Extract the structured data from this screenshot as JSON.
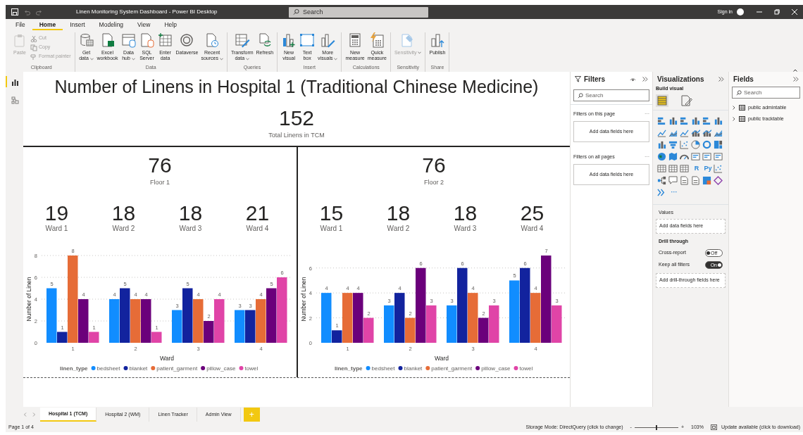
{
  "window": {
    "title": "Linen Monitoring System Dashboard - Power BI Desktop",
    "search_placeholder": "Search",
    "sign_in": "Sign in"
  },
  "menu_tabs": [
    {
      "label": "File",
      "selected": false
    },
    {
      "label": "Home",
      "selected": true
    },
    {
      "label": "Insert",
      "selected": false
    },
    {
      "label": "Modeling",
      "selected": false
    },
    {
      "label": "View",
      "selected": false
    },
    {
      "label": "Help",
      "selected": false
    }
  ],
  "ribbon": [
    {
      "label": "Clipboard",
      "buttons": [
        {
          "kind": "large",
          "lines": [
            "Paste"
          ],
          "disabled": true
        },
        {
          "kind": "small",
          "lines": [
            "Cut"
          ],
          "disabled": true
        },
        {
          "kind": "small",
          "lines": [
            "Copy"
          ],
          "disabled": true
        },
        {
          "kind": "small",
          "lines": [
            "Format painter"
          ],
          "disabled": true
        }
      ]
    },
    {
      "label": "Data",
      "buttons": [
        {
          "kind": "large",
          "lines": [
            "Get",
            "data"
          ],
          "dropdown": true,
          "disabled": false
        },
        {
          "kind": "large",
          "lines": [
            "Excel",
            "workbook"
          ],
          "disabled": false
        },
        {
          "kind": "large",
          "lines": [
            "Data",
            "hub"
          ],
          "dropdown": true,
          "disabled": false
        },
        {
          "kind": "large",
          "lines": [
            "SQL",
            "Server"
          ],
          "disabled": false
        },
        {
          "kind": "large",
          "lines": [
            "Enter",
            "data"
          ],
          "disabled": false
        },
        {
          "kind": "large",
          "lines": [
            "Dataverse"
          ],
          "disabled": false
        },
        {
          "kind": "large",
          "lines": [
            "Recent",
            "sources"
          ],
          "dropdown": true,
          "disabled": false
        }
      ]
    },
    {
      "label": "Queries",
      "buttons": [
        {
          "kind": "large",
          "lines": [
            "Transform",
            "data"
          ],
          "dropdown": true,
          "disabled": false
        },
        {
          "kind": "large",
          "lines": [
            "Refresh"
          ],
          "disabled": false
        }
      ]
    },
    {
      "label": "Insert",
      "buttons": [
        {
          "kind": "large",
          "lines": [
            "New",
            "visual"
          ],
          "disabled": false
        },
        {
          "kind": "large",
          "lines": [
            "Text",
            "box"
          ],
          "disabled": false
        },
        {
          "kind": "large",
          "lines": [
            "More",
            "visuals"
          ],
          "dropdown": true,
          "disabled": false
        }
      ]
    },
    {
      "label": "Calculations",
      "buttons": [
        {
          "kind": "large",
          "lines": [
            "New",
            "measure"
          ],
          "disabled": false
        },
        {
          "kind": "large",
          "lines": [
            "Quick",
            "measure"
          ],
          "disabled": false
        }
      ]
    },
    {
      "label": "Sensitivity",
      "buttons": [
        {
          "kind": "large",
          "lines": [
            "Sensitivity"
          ],
          "dropdown": true,
          "disabled": true
        }
      ]
    },
    {
      "label": "Share",
      "buttons": [
        {
          "kind": "large",
          "lines": [
            "Publish"
          ],
          "disabled": false
        }
      ]
    }
  ],
  "view_rail": [
    {
      "selected": true
    },
    {
      "selected": false
    }
  ],
  "report": {
    "title": "Number of Linens in Hospital 1 (Traditional Chinese Medicine)",
    "total": {
      "value": "152",
      "label": "Total Linens in TCM"
    },
    "floors": [
      {
        "total": "76",
        "label": "Floor 1",
        "wards": [
          {
            "value": "19",
            "label": "Ward 1"
          },
          {
            "value": "18",
            "label": "Ward 2"
          },
          {
            "value": "18",
            "label": "Ward 3"
          },
          {
            "value": "21",
            "label": "Ward 4"
          }
        ],
        "chart_data": {
          "type": "bar",
          "xlabel": "Ward",
          "ylabel": "Number of Linen",
          "categories": [
            "1",
            "2",
            "3",
            "4"
          ],
          "ylim": [
            0,
            8
          ],
          "yticks": [
            0,
            2,
            4,
            6,
            8
          ],
          "data_labels": true,
          "grid": true,
          "legend": {
            "title": "linen_type"
          },
          "series": [
            {
              "name": "bedsheet",
              "color": "#118dff",
              "values": [
                5,
                4,
                3,
                3
              ]
            },
            {
              "name": "blanket",
              "color": "#12239e",
              "values": [
                1,
                5,
                5,
                3
              ]
            },
            {
              "name": "patient_garment",
              "color": "#e66c37",
              "values": [
                8,
                4,
                4,
                4
              ]
            },
            {
              "name": "pillow_case",
              "color": "#6b007b",
              "values": [
                4,
                4,
                2,
                5
              ]
            },
            {
              "name": "towel",
              "color": "#e044a7",
              "values": [
                1,
                1,
                4,
                6
              ]
            }
          ]
        }
      },
      {
        "total": "76",
        "label": "Floor 2",
        "wards": [
          {
            "value": "15",
            "label": "Ward 1"
          },
          {
            "value": "18",
            "label": "Ward 2"
          },
          {
            "value": "18",
            "label": "Ward 3"
          },
          {
            "value": "25",
            "label": "Ward 4"
          }
        ],
        "chart_data": {
          "type": "bar",
          "xlabel": "Ward",
          "ylabel": "Number of Linen",
          "categories": [
            "1",
            "2",
            "3",
            "4"
          ],
          "ylim": [
            0,
            7
          ],
          "yticks": [
            0,
            2,
            4,
            6
          ],
          "data_labels": true,
          "grid": true,
          "legend": {
            "title": "linen_type"
          },
          "series": [
            {
              "name": "bedsheet",
              "color": "#118dff",
              "values": [
                4,
                3,
                3,
                5
              ]
            },
            {
              "name": "blanket",
              "color": "#12239e",
              "values": [
                1,
                4,
                6,
                6
              ]
            },
            {
              "name": "patient_garment",
              "color": "#e66c37",
              "values": [
                4,
                2,
                4,
                4
              ]
            },
            {
              "name": "pillow_case",
              "color": "#6b007b",
              "values": [
                4,
                6,
                2,
                7
              ]
            },
            {
              "name": "towel",
              "color": "#e044a7",
              "values": [
                2,
                3,
                3,
                3
              ]
            }
          ]
        }
      }
    ]
  },
  "filters_pane": {
    "title": "Filters",
    "search_placeholder": "Search",
    "sections": [
      {
        "label": "Filters on this page",
        "more": "···",
        "drop_text": "Add data fields here"
      },
      {
        "label": "Filters on all pages",
        "more": "···",
        "drop_text": "Add data fields here"
      }
    ]
  },
  "visualizations_pane": {
    "title": "Visualizations",
    "subtitle": "Build visual",
    "tabs": [
      {
        "selected": true
      },
      {
        "selected": false
      }
    ],
    "visual_icons": [
      {
        "kind": "bar"
      },
      {
        "kind": "column"
      },
      {
        "kind": "bar"
      },
      {
        "kind": "column"
      },
      {
        "kind": "bar"
      },
      {
        "kind": "column"
      },
      {
        "kind": "line"
      },
      {
        "kind": "area"
      },
      {
        "kind": "line"
      },
      {
        "kind": "combo"
      },
      {
        "kind": "combo"
      },
      {
        "kind": "area"
      },
      {
        "kind": "column"
      },
      {
        "kind": "funnel"
      },
      {
        "kind": "scatter"
      },
      {
        "kind": "pie"
      },
      {
        "kind": "donut"
      },
      {
        "kind": "treemap"
      },
      {
        "kind": "globe"
      },
      {
        "kind": "map"
      },
      {
        "kind": "gauge"
      },
      {
        "kind": "card"
      },
      {
        "kind": "card"
      },
      {
        "kind": "card"
      },
      {
        "kind": "table"
      },
      {
        "kind": "table"
      },
      {
        "kind": "table"
      },
      {
        "kind": "text",
        "label": "R"
      },
      {
        "kind": "text",
        "label": "Py"
      },
      {
        "kind": "scatter"
      },
      {
        "kind": "tree"
      },
      {
        "kind": "bubble"
      },
      {
        "kind": "doc"
      },
      {
        "kind": "doc"
      },
      {
        "kind": "apps"
      },
      {
        "kind": "diamond"
      },
      {
        "kind": "chevron"
      },
      {
        "kind": "text",
        "label": "···"
      }
    ],
    "values_label": "Values",
    "values_drop": "Add data fields here",
    "drill_title": "Drill through",
    "toggles": [
      {
        "label": "Cross-report",
        "on": false,
        "text": "Off"
      },
      {
        "label": "Keep all filters",
        "on": true,
        "text": "On"
      }
    ],
    "drill_drop": "Add drill-through fields here"
  },
  "fields_pane": {
    "title": "Fields",
    "search_placeholder": "Search",
    "tables": [
      {
        "name": "public admintable",
        "expanded": false
      },
      {
        "name": "public tracktable",
        "expanded": false
      }
    ]
  },
  "page_tabs": [
    {
      "label": "Hospital 1 (TCM)",
      "selected": true
    },
    {
      "label": "Hospital 2 (WM)",
      "selected": false
    },
    {
      "label": "Linen Tracker",
      "selected": false
    },
    {
      "label": "Admin View",
      "selected": false
    }
  ],
  "add_page": "+",
  "status_bar": {
    "page": "Page 1 of 4",
    "storage": "Storage Mode: DirectQuery (click to change)",
    "zoom_minus": "-",
    "zoom": {
      "level": 0.5
    },
    "zoom_plus": "+",
    "zoom_text": "103%",
    "update": "Update available (click to download)"
  }
}
